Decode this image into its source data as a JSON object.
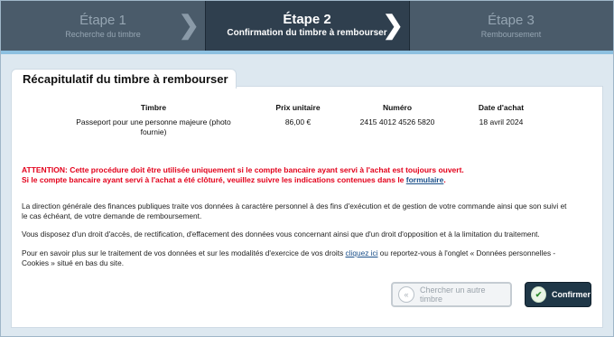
{
  "steps": [
    {
      "title": "Étape 1",
      "subtitle": "Recherche du timbre"
    },
    {
      "title": "Étape 2",
      "subtitle": "Confirmation du timbre à rembourser"
    },
    {
      "title": "Étape 3",
      "subtitle": "Remboursement"
    }
  ],
  "panel": {
    "title": "Récapitulatif du timbre à rembourser"
  },
  "table": {
    "headers": [
      "Timbre",
      "Prix unitaire",
      "Numéro",
      "Date d'achat"
    ],
    "row": {
      "timbre_line1": "Passeport pour une personne majeure (photo",
      "timbre_line2": "fournie)",
      "prix": "86,00 €",
      "numero": "2415 4012 4526 5820",
      "date": "18 avril 2024"
    }
  },
  "warning": {
    "line1": "ATTENTION: Cette procédure doit être utilisée uniquement si le compte bancaire ayant servi à l'achat est toujours ouvert.",
    "line2_prefix": "Si le compte bancaire ayant servi à l'achat a été clôturé, veuillez suivre les indications contenues dans le ",
    "link": "formulaire",
    "line2_suffix": "."
  },
  "paragraphs": {
    "p1_line1": "La direction générale des finances publiques traite vos données à caractère personnel à des fins d'exécution et de gestion de votre commande ainsi que son suivi et",
    "p1_line2": "le cas échéant, de votre demande de remboursement.",
    "p2": "Vous disposez d'un droit d'accès, de rectification, d'effacement des données vous concernant ainsi que d'un droit d'opposition et à la limitation du traitement.",
    "p3_prefix": "Pour en savoir plus sur le traitement de vos données et sur les modalités d'exercice de vos droits ",
    "p3_link": "cliquez ici",
    "p3_suffix": " ou reportez-vous à l'onglet « Données personnelles -",
    "p3_line2": "Cookies » situé en bas du site."
  },
  "buttons": {
    "other": "Chercher un autre timbre",
    "confirm": "Confirmer"
  },
  "icons": {
    "step_arrow": "chevron-right-icon",
    "back": "double-chevron-left-icon",
    "confirm": "check-circle-icon"
  },
  "colors": {
    "step_active": "#2f3f4e",
    "step_inactive": "#4a5b6a",
    "warning": "#e3001b",
    "confirm_button": "#1f3747"
  }
}
